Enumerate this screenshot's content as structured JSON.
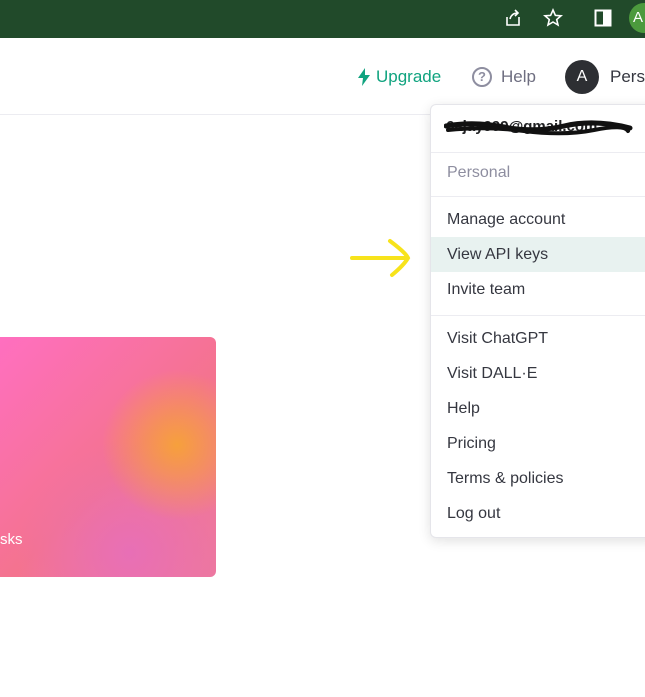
{
  "browser": {
    "icons": [
      "share-icon",
      "star-icon",
      "side-panel-icon"
    ],
    "profile_initial": "A"
  },
  "header": {
    "upgrade_label": "Upgrade",
    "help_label": "Help",
    "avatar_initial": "A",
    "account_name": "Pers"
  },
  "card": {
    "text": "sks"
  },
  "menu": {
    "email": "6ajay999@gmail.com",
    "section_label": "Personal",
    "group1": [
      "Manage account",
      "View API keys",
      "Invite team"
    ],
    "group2": [
      "Visit ChatGPT",
      "Visit DALL·E",
      "Help",
      "Pricing",
      "Terms & policies",
      "Log out"
    ],
    "active_item": "View API keys"
  },
  "colors": {
    "accent": "#10a37f",
    "browser_bar": "#214a2a",
    "active_item_bg": "#e8f2f0",
    "annotation_arrow": "#f7e31b"
  }
}
